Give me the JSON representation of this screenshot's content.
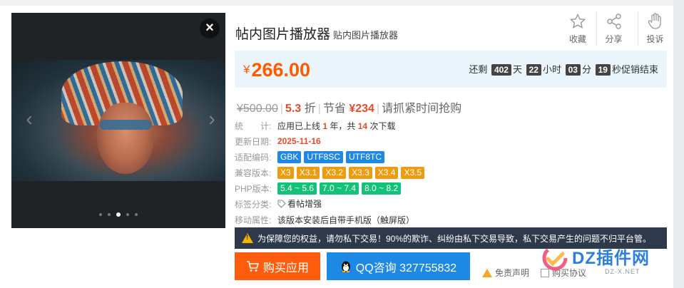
{
  "gallery": {
    "close_label": "×",
    "prev_label": "‹",
    "next_label": "›",
    "dot_count": 5,
    "active_dot": 2
  },
  "product": {
    "title": "帖内图片播放器",
    "subtitle": "贴内图片播放器"
  },
  "actions": [
    {
      "label": "收藏",
      "icon": "star-icon"
    },
    {
      "label": "分享",
      "icon": "share-icon"
    },
    {
      "label": "投诉",
      "icon": "hand-icon"
    }
  ],
  "price": {
    "currency": "¥",
    "value": "266.00"
  },
  "countdown": {
    "prefix": "还剩",
    "days": "402",
    "days_unit": "天",
    "hours": "22",
    "hours_unit": "小时",
    "minutes": "03",
    "minutes_unit": "分",
    "seconds": "19",
    "suffix": "秒促销结束"
  },
  "discount": {
    "original": "¥500.00",
    "sep": "|",
    "rate": "5.3",
    "rate_unit": "折",
    "save_label": "节省",
    "save_amount": "¥234",
    "hint": "请抓紧时间抢购"
  },
  "stats": {
    "label": "统　　计:",
    "online_prefix": "应用已上线",
    "years": "1",
    "online_mid": "年，共",
    "downloads": "14",
    "online_suffix": "次下载"
  },
  "updated": {
    "label": "更新日期:",
    "date": "2025-11-16"
  },
  "encoding": {
    "label": "适配编码:",
    "tags": [
      "GBK",
      "UTF8SC",
      "UTF8TC"
    ]
  },
  "versions": {
    "label": "兼容版本:",
    "tags": [
      "X3",
      "X3.1",
      "X3.2",
      "X3.3",
      "X3.4",
      "X3.5"
    ]
  },
  "php": {
    "label": "PHP版本:",
    "tags": [
      "5.4 ~ 5.6",
      "7.0 ~ 7.4",
      "8.0 ~ 8.2"
    ]
  },
  "category": {
    "label": "标签分类:",
    "value": "看帖增强"
  },
  "mobile": {
    "label": "移动属性:",
    "value": "该版本安装后自带手机版（触屏版）"
  },
  "notice": {
    "text": "为保障您的权益，请勿私下交易！90%的欺诈、纠纷由私下交易导致，私下交易产生的问题不归平台管。"
  },
  "buttons": {
    "buy": "购买应用",
    "qq": "QQ咨询 327755832"
  },
  "footer": {
    "disclaimer": "免责声明",
    "agree": "购买协议"
  },
  "watermark": {
    "brand": "DZ插件网",
    "url": "DZ-X.NET"
  },
  "colors": {
    "accent": "#ff5a00",
    "price_bg": "#eaf5fc",
    "blue_tag": "#1e88e5",
    "orange_tag": "#ef9b0f",
    "green_tag": "#13c27a",
    "notice_bg": "#2e3a4c"
  }
}
